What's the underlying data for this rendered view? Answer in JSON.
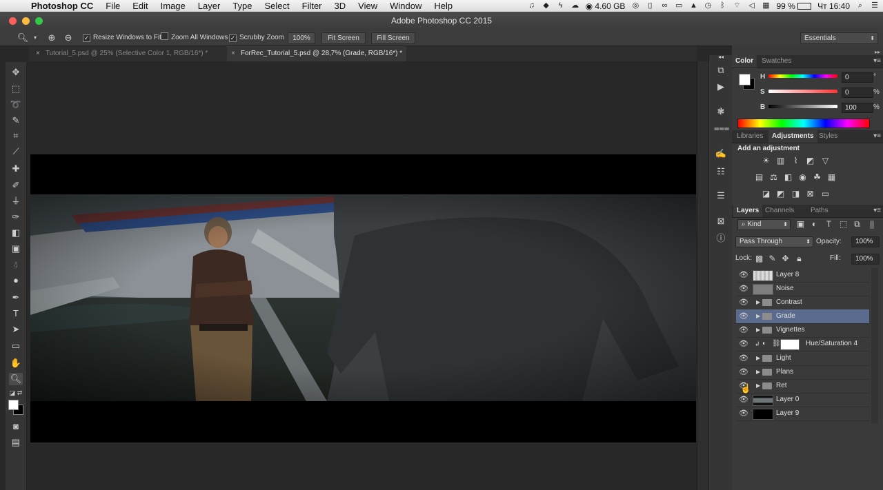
{
  "menubar": {
    "apple_icon": "apple-icon",
    "items": [
      "Photoshop CC",
      "File",
      "Edit",
      "Image",
      "Layer",
      "Type",
      "Select",
      "Filter",
      "3D",
      "View",
      "Window",
      "Help"
    ],
    "status": {
      "memory": "4.60 GB",
      "battery": "99 %",
      "clock": "Чт 16:40"
    }
  },
  "window": {
    "title": "Adobe Photoshop CC 2015",
    "traffic_lights": [
      "#fc615d",
      "#fdbc40",
      "#34c84a"
    ]
  },
  "options_bar": {
    "resize_windows_to_fit": "Resize Windows to Fit",
    "zoom_all_windows": "Zoom All Windows",
    "scrubby_zoom": "Scrubby Zoom",
    "zoom_100": "100%",
    "fit_screen": "Fit Screen",
    "fill_screen": "Fill Screen",
    "workspace": "Essentials"
  },
  "tabs": [
    {
      "label": "Tutorial_5.psd @ 25% (Selective Color 1, RGB/16*) *",
      "active": false
    },
    {
      "label": "ForRec_Tutorial_5.psd @ 28,7% (Grade, RGB/16*) *",
      "active": true
    }
  ],
  "color_panel": {
    "tabs": [
      "Color",
      "Swatches"
    ],
    "h_label": "H",
    "h_value": "0",
    "h_unit": "°",
    "s_label": "S",
    "s_value": "0",
    "s_unit": "%",
    "b_label": "B",
    "b_value": "100",
    "b_unit": "%"
  },
  "adjustments_panel": {
    "tabs": [
      "Libraries",
      "Adjustments",
      "Styles"
    ],
    "heading": "Add an adjustment"
  },
  "layers_panel": {
    "tabs": [
      "Layers",
      "Channels",
      "Paths"
    ],
    "filter": "Kind",
    "blend_mode": "Pass Through",
    "opacity_label": "Opacity:",
    "opacity": "100%",
    "lock_label": "Lock:",
    "fill_label": "Fill:",
    "fill": "100%",
    "layers": [
      {
        "name": "Layer 8",
        "kind": "pixel"
      },
      {
        "name": "Noise",
        "kind": "pixel"
      },
      {
        "name": "Contrast",
        "kind": "group"
      },
      {
        "name": "Grade",
        "kind": "group",
        "selected": true
      },
      {
        "name": "Vignettes",
        "kind": "group"
      },
      {
        "name": "Hue/Saturation 4",
        "kind": "adjustment"
      },
      {
        "name": "Light",
        "kind": "group"
      },
      {
        "name": "Plans",
        "kind": "group"
      },
      {
        "name": "Ret",
        "kind": "group"
      },
      {
        "name": "Layer 0",
        "kind": "pixel"
      },
      {
        "name": "Layer 9",
        "kind": "pixel"
      }
    ]
  },
  "colors": {
    "selection": "#5b6b8e",
    "panel_bg": "#3a3a3a",
    "workspace_bg": "#282828"
  }
}
